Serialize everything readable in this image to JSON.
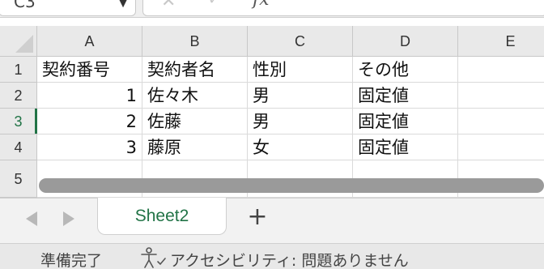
{
  "name_box": {
    "value": "C3"
  },
  "formula_bar": {
    "fx": "fx",
    "cancel_icon": "x-icon",
    "confirm_icon": "check-icon"
  },
  "columns": [
    "A",
    "B",
    "C",
    "D",
    "E"
  ],
  "rows": [
    "1",
    "2",
    "3",
    "4",
    "5"
  ],
  "active_row": "3",
  "cells": {
    "r1": {
      "A": "契約番号",
      "B": "契約者名",
      "C": "性別",
      "D": "その他",
      "E": ""
    },
    "r2": {
      "A": "1",
      "B": "佐々木",
      "C": "男",
      "D": "固定値",
      "E": ""
    },
    "r3": {
      "A": "2",
      "B": "佐藤",
      "C": "男",
      "D": "固定値",
      "E": ""
    },
    "r4": {
      "A": "3",
      "B": "藤原",
      "C": "女",
      "D": "固定値",
      "E": ""
    },
    "r5": {
      "A": "",
      "B": "",
      "C": "",
      "D": "",
      "E": ""
    }
  },
  "sheet_tabs": {
    "active": "Sheet2",
    "add_label": "+"
  },
  "status_bar": {
    "ready": "準備完了",
    "accessibility": "アクセシビリティ: 問題ありません"
  },
  "colors": {
    "accent": "#217346",
    "header_bg": "#e9e9e9",
    "grid_line": "#dadada"
  }
}
